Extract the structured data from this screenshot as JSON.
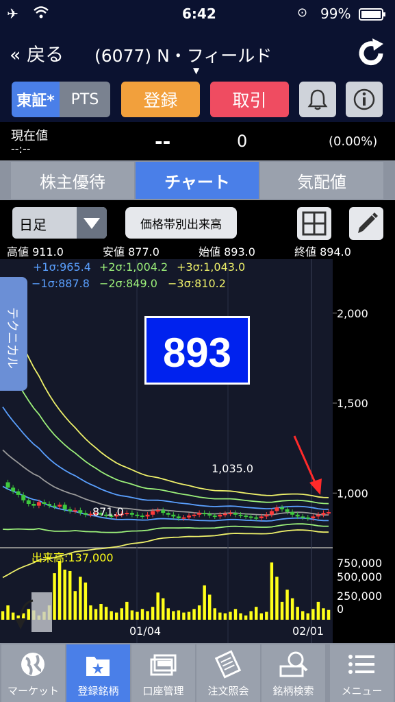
{
  "status": {
    "time": "6:42",
    "battery": "99%"
  },
  "nav": {
    "back_label": "« 戻る",
    "title": "(6077) N・フィールド"
  },
  "toolbar": {
    "tse": "東証*",
    "pts": "PTS",
    "register": "登録",
    "trade": "取引"
  },
  "price": {
    "label": "現在値",
    "time": "--:--",
    "value": "--",
    "change": "0",
    "pct": "(0.00%)"
  },
  "tabs": {
    "yutai": "株主優待",
    "chart": "チャート",
    "kehai": "気配値"
  },
  "controls": {
    "period": "日足",
    "volume_profile": "価格帯別出来高"
  },
  "ohlc": {
    "high": "高値 911.0",
    "low": "安値 877.0",
    "open": "始値 893.0",
    "close": "終値 894.0"
  },
  "bands": {
    "p1": "+1σ:965.4",
    "p2": "+2σ:1,004.2",
    "p3": "+3σ:1,043.0",
    "m1": "−1σ:887.8",
    "m2": "−2σ:849.0",
    "m3": "−3σ:810.2"
  },
  "technical_tab": "テクニカル",
  "big_price": "893",
  "annotations": {
    "high_mark": "1,035.0",
    "low_mark": "871.0"
  },
  "volume_label": "出来高:137,000",
  "colors": {
    "p1": "#5aa0ff",
    "p2": "#9cf07a",
    "p3": "#eef06a",
    "m1": "#5aa0ff",
    "m2": "#9cf07a",
    "m3": "#eef06a",
    "up": "#ff3a3a",
    "down": "#3ec83e",
    "volume": "#ffff1a",
    "accent": "#4a7fe8"
  },
  "chart_data": {
    "type": "candlestick",
    "price_axis": {
      "ticks": [
        "2,000",
        "1,500",
        "1,000"
      ],
      "ylim": [
        700,
        2300
      ]
    },
    "volume_axis": {
      "ticks": [
        "750,000",
        "500,000",
        "250,000",
        "0"
      ]
    },
    "x_ticks": [
      "01/04",
      "02/01"
    ],
    "closes": [
      1060,
      1030,
      1010,
      990,
      960,
      940,
      930,
      950,
      940,
      930,
      925,
      935,
      910,
      900,
      905,
      890,
      880,
      885,
      890,
      880,
      875,
      870,
      880,
      885,
      890,
      880,
      875,
      870,
      880,
      900,
      905,
      890,
      880,
      870,
      860,
      865,
      875,
      880,
      890,
      885,
      875,
      870,
      880,
      885,
      890,
      880,
      875,
      870,
      865,
      860,
      870,
      880,
      900,
      920,
      910,
      895,
      880,
      870,
      865,
      860,
      870,
      880,
      890,
      894
    ],
    "volumes": [
      120,
      200,
      100,
      60,
      90,
      150,
      130,
      60,
      110,
      200,
      650,
      820,
      700,
      680,
      400,
      600,
      520,
      200,
      150,
      220,
      180,
      120,
      100,
      160,
      250,
      130,
      110,
      150,
      120,
      180,
      380,
      300,
      160,
      120,
      130,
      100,
      110,
      150,
      200,
      480,
      350,
      160,
      100,
      90,
      110,
      150,
      90,
      60,
      120,
      180,
      90,
      110,
      800,
      600,
      250,
      420,
      300,
      180,
      120,
      90,
      150,
      250,
      160,
      137
    ]
  },
  "bottom_tabs": [
    "マーケット",
    "登録銘柄",
    "口座管理",
    "注文照会",
    "銘柄検索",
    "メニュー"
  ]
}
